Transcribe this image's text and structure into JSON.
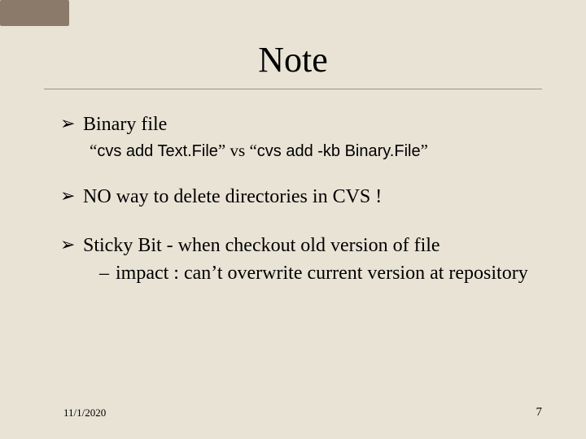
{
  "title": "Note",
  "bullets": {
    "b1": "Binary file",
    "b1_sub_q1": "“",
    "b1_sub_cmd1": "cvs add Text.File",
    "b1_sub_q2": "”",
    "b1_sub_vs": " vs ",
    "b1_sub_q3": "“",
    "b1_sub_cmd2": "cvs add -kb Binary.File",
    "b1_sub_q4": "”",
    "b2": "NO way to delete directories in CVS !",
    "b3": "Sticky Bit - when checkout old version of file",
    "b3_sub": "impact : can’t overwrite current version at repository"
  },
  "footer": {
    "date": "11/1/2020",
    "page": "7"
  }
}
